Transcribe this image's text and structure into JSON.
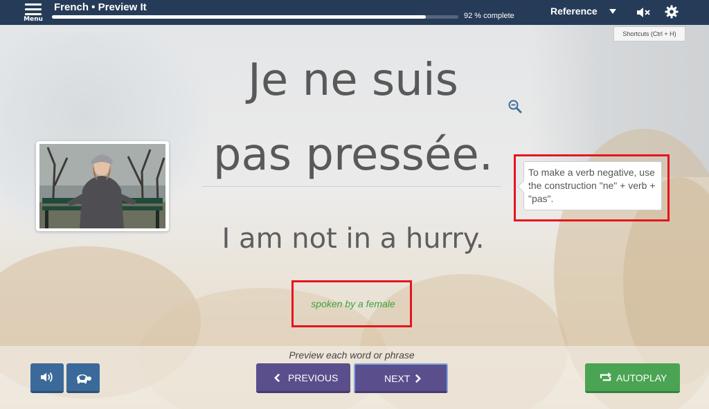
{
  "header": {
    "menu_label": "Menu",
    "title": "French • Preview It",
    "progress_percent": 92,
    "progress_text": "92 % complete",
    "reference_label": "Reference",
    "icons": [
      "menu-icon",
      "caret-down-icon",
      "mute-icon",
      "gear-icon"
    ]
  },
  "shortcuts_label": "Shortcuts (Ctrl + H)",
  "card": {
    "phrase_fr_line1": "Je ne suis",
    "phrase_fr_line2": "pas pressée.",
    "phrase_en": "I am not in a hurry.",
    "tooltip": "To make a verb negative, use the construction \"ne\" + verb + \"pas\".",
    "spoken_by": "spoken by a female"
  },
  "footer": {
    "instruction": "Preview each word or phrase",
    "previous_label": "PREVIOUS",
    "next_label": "NEXT",
    "autoplay_label": "AUTOPLAY"
  },
  "colors": {
    "topbar": "#263b57",
    "highlight_border": "#e4151f",
    "spoken_text": "#3ea33a",
    "nav_button": "#5a4f8c",
    "audio_button": "#3b6a9a",
    "autoplay_button": "#4aa453"
  }
}
